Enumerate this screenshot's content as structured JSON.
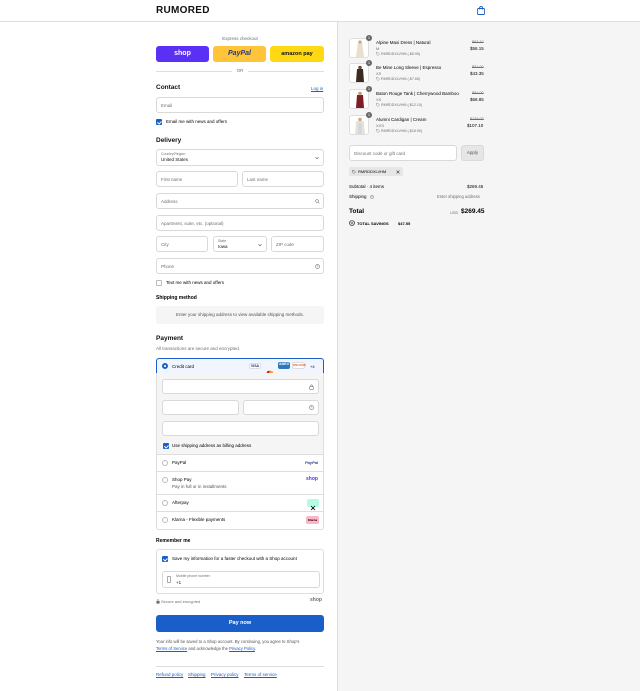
{
  "header": {
    "logo": "RUMORED",
    "bag_icon": "shopping-bag-icon"
  },
  "express": {
    "label": "Express checkout",
    "shop_label": "shop",
    "paypal_label": "PayPal",
    "amazon_label": "amazon pay",
    "or_label": "OR",
    "colors": {
      "shop": "#5a31f4",
      "paypal": "#ffc439",
      "amazon": "#ffd814"
    }
  },
  "contact": {
    "title": "Contact",
    "login_link": "Log in",
    "email_placeholder": "Email",
    "news_label": "Email me with news and offers"
  },
  "delivery": {
    "title": "Delivery",
    "country_label": "Country/Region",
    "country_value": "United States",
    "first_name": "First name",
    "last_name": "Last name",
    "address": "Address",
    "apartment": "Apartment, suite, etc. (optional)",
    "city": "City",
    "state_label": "State",
    "state_value": "Iowa",
    "zip": "ZIP code",
    "phone": "Phone",
    "text_news": "Text me with news and offers"
  },
  "shipping": {
    "title": "Shipping method",
    "notice": "Enter your shipping address to view available shipping methods."
  },
  "payment": {
    "title": "Payment",
    "subtitle": "All transactions are secure and encrypted.",
    "credit_card_label": "Credit card",
    "card_brands": [
      "VISA",
      "mc",
      "AMEX",
      "DISCOVER"
    ],
    "more_brands": "+4",
    "billing_label": "Use shipping address as billing address",
    "options": [
      {
        "label": "PayPal",
        "logo": "PayPal"
      },
      {
        "label": "Shop Pay",
        "sub": "Pay in full or in installments",
        "logo": "shop"
      },
      {
        "label": "Afterpay",
        "logo": "afterpay"
      },
      {
        "label": "Klarna - Flexible payments",
        "logo": "Klarna"
      }
    ]
  },
  "remember": {
    "title": "Remember me",
    "save_label": "Save my information for a faster checkout with a Shop account",
    "mobile_label": "Mobile phone number",
    "mobile_value": "+1"
  },
  "secure": {
    "label": "Secure and encrypted",
    "shop_logo": "shop"
  },
  "pay_now": "Pay now",
  "disclaimer": {
    "text": "Your info will be saved to a Shop account. By continuing, you agree to Shop's",
    "terms": "Terms of Service",
    "mid": "and acknowledge the",
    "privacy": "Privacy Policy",
    "end": "."
  },
  "footer_links": [
    "Refund policy",
    "Shipping",
    "Privacy policy",
    "Terms of service"
  ],
  "cart": {
    "items": [
      {
        "qty": "1",
        "name": "Alpine Maxi Dress | Natural",
        "variant": "M",
        "code": "RMRDDXLVHM (-$6.95)",
        "orig": "$63.10",
        "price": "$56.15"
      },
      {
        "qty": "1",
        "name": "Be Mine Long Sleeve | Espresso",
        "variant": "XS",
        "code": "RMRDDXLVHM (-$7.65)",
        "orig": "$51.00",
        "price": "$43.35"
      },
      {
        "qty": "1",
        "name": "Baton Rouge Tank | Cherrywood Bamboo",
        "variant": "XS",
        "code": "RMRDDXLVHM (-$12.15)",
        "orig": "$81.00",
        "price": "$68.85"
      },
      {
        "qty": "1",
        "name": "Alumni Cardigan | Cream",
        "variant": "XXS",
        "code": "RMRDDXLVHM (-$18.90)",
        "orig": "$126.00",
        "price": "$107.10"
      }
    ],
    "discount_placeholder": "Discount code or gift card",
    "apply_label": "Apply",
    "applied_code": "RMRDDXLVHM",
    "subtotal_label": "Subtotal · 4 items",
    "subtotal_value": "$269.45",
    "shipping_label": "Shipping",
    "shipping_value": "Enter shipping address",
    "total_label": "Total",
    "currency": "USD",
    "total_value": "$269.45",
    "savings_label": "TOTAL SAVINGS",
    "savings_value": "$47.55"
  }
}
